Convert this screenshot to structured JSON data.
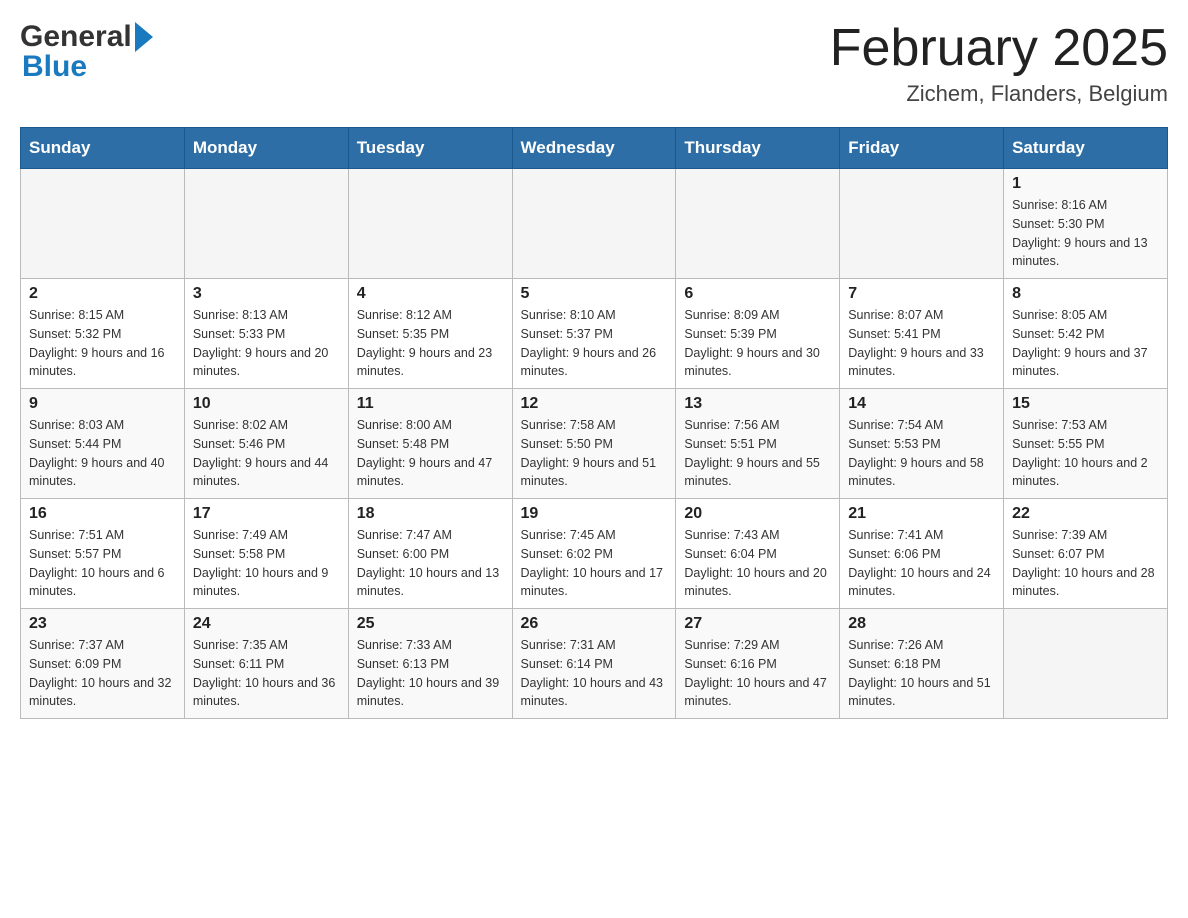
{
  "header": {
    "logo_general": "General",
    "logo_blue": "Blue",
    "title": "February 2025",
    "location": "Zichem, Flanders, Belgium"
  },
  "calendar": {
    "days_of_week": [
      "Sunday",
      "Monday",
      "Tuesday",
      "Wednesday",
      "Thursday",
      "Friday",
      "Saturday"
    ],
    "weeks": [
      [
        {
          "day": "",
          "info": ""
        },
        {
          "day": "",
          "info": ""
        },
        {
          "day": "",
          "info": ""
        },
        {
          "day": "",
          "info": ""
        },
        {
          "day": "",
          "info": ""
        },
        {
          "day": "",
          "info": ""
        },
        {
          "day": "1",
          "info": "Sunrise: 8:16 AM\nSunset: 5:30 PM\nDaylight: 9 hours and 13 minutes."
        }
      ],
      [
        {
          "day": "2",
          "info": "Sunrise: 8:15 AM\nSunset: 5:32 PM\nDaylight: 9 hours and 16 minutes."
        },
        {
          "day": "3",
          "info": "Sunrise: 8:13 AM\nSunset: 5:33 PM\nDaylight: 9 hours and 20 minutes."
        },
        {
          "day": "4",
          "info": "Sunrise: 8:12 AM\nSunset: 5:35 PM\nDaylight: 9 hours and 23 minutes."
        },
        {
          "day": "5",
          "info": "Sunrise: 8:10 AM\nSunset: 5:37 PM\nDaylight: 9 hours and 26 minutes."
        },
        {
          "day": "6",
          "info": "Sunrise: 8:09 AM\nSunset: 5:39 PM\nDaylight: 9 hours and 30 minutes."
        },
        {
          "day": "7",
          "info": "Sunrise: 8:07 AM\nSunset: 5:41 PM\nDaylight: 9 hours and 33 minutes."
        },
        {
          "day": "8",
          "info": "Sunrise: 8:05 AM\nSunset: 5:42 PM\nDaylight: 9 hours and 37 minutes."
        }
      ],
      [
        {
          "day": "9",
          "info": "Sunrise: 8:03 AM\nSunset: 5:44 PM\nDaylight: 9 hours and 40 minutes."
        },
        {
          "day": "10",
          "info": "Sunrise: 8:02 AM\nSunset: 5:46 PM\nDaylight: 9 hours and 44 minutes."
        },
        {
          "day": "11",
          "info": "Sunrise: 8:00 AM\nSunset: 5:48 PM\nDaylight: 9 hours and 47 minutes."
        },
        {
          "day": "12",
          "info": "Sunrise: 7:58 AM\nSunset: 5:50 PM\nDaylight: 9 hours and 51 minutes."
        },
        {
          "day": "13",
          "info": "Sunrise: 7:56 AM\nSunset: 5:51 PM\nDaylight: 9 hours and 55 minutes."
        },
        {
          "day": "14",
          "info": "Sunrise: 7:54 AM\nSunset: 5:53 PM\nDaylight: 9 hours and 58 minutes."
        },
        {
          "day": "15",
          "info": "Sunrise: 7:53 AM\nSunset: 5:55 PM\nDaylight: 10 hours and 2 minutes."
        }
      ],
      [
        {
          "day": "16",
          "info": "Sunrise: 7:51 AM\nSunset: 5:57 PM\nDaylight: 10 hours and 6 minutes."
        },
        {
          "day": "17",
          "info": "Sunrise: 7:49 AM\nSunset: 5:58 PM\nDaylight: 10 hours and 9 minutes."
        },
        {
          "day": "18",
          "info": "Sunrise: 7:47 AM\nSunset: 6:00 PM\nDaylight: 10 hours and 13 minutes."
        },
        {
          "day": "19",
          "info": "Sunrise: 7:45 AM\nSunset: 6:02 PM\nDaylight: 10 hours and 17 minutes."
        },
        {
          "day": "20",
          "info": "Sunrise: 7:43 AM\nSunset: 6:04 PM\nDaylight: 10 hours and 20 minutes."
        },
        {
          "day": "21",
          "info": "Sunrise: 7:41 AM\nSunset: 6:06 PM\nDaylight: 10 hours and 24 minutes."
        },
        {
          "day": "22",
          "info": "Sunrise: 7:39 AM\nSunset: 6:07 PM\nDaylight: 10 hours and 28 minutes."
        }
      ],
      [
        {
          "day": "23",
          "info": "Sunrise: 7:37 AM\nSunset: 6:09 PM\nDaylight: 10 hours and 32 minutes."
        },
        {
          "day": "24",
          "info": "Sunrise: 7:35 AM\nSunset: 6:11 PM\nDaylight: 10 hours and 36 minutes."
        },
        {
          "day": "25",
          "info": "Sunrise: 7:33 AM\nSunset: 6:13 PM\nDaylight: 10 hours and 39 minutes."
        },
        {
          "day": "26",
          "info": "Sunrise: 7:31 AM\nSunset: 6:14 PM\nDaylight: 10 hours and 43 minutes."
        },
        {
          "day": "27",
          "info": "Sunrise: 7:29 AM\nSunset: 6:16 PM\nDaylight: 10 hours and 47 minutes."
        },
        {
          "day": "28",
          "info": "Sunrise: 7:26 AM\nSunset: 6:18 PM\nDaylight: 10 hours and 51 minutes."
        },
        {
          "day": "",
          "info": ""
        }
      ]
    ]
  }
}
